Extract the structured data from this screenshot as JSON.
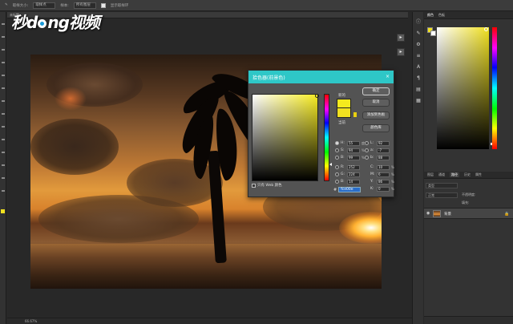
{
  "options_bar": {
    "sample_size_label": "取样大小:",
    "sample_size_value": "取样点",
    "sample_label": "样本:",
    "sample_value": "所有图层",
    "show_ring_label": "显示取样环"
  },
  "watermark": {
    "part1": "秒",
    "part2": "d",
    "part3": "ng视频"
  },
  "doc_tab": {
    "title": "未标题"
  },
  "color_panel": {
    "tabs": [
      "颜色",
      "色板"
    ],
    "fg_color": "#f0e020",
    "bg_color": "#ffffff"
  },
  "layers_panel": {
    "tabs": [
      "图层",
      "通道",
      "路径",
      "历史",
      "属性"
    ],
    "active_tab": "图层",
    "filter_label": "类型",
    "blend_mode": "正常",
    "opacity_label": "不透明度:",
    "fill_label": "填充:",
    "layer_name": "背景"
  },
  "status_bar": {
    "text": "66.67%"
  },
  "dialog": {
    "title": "拾色器(前景色)",
    "new_label": "新的",
    "current_label": "当前",
    "buttons": [
      "确定",
      "取消",
      "添加到色板",
      "颜色库"
    ],
    "only_web_label": "只有 Web 颜色",
    "hsb": [
      {
        "label": "H:",
        "value": "55",
        "unit": "度",
        "on": true
      },
      {
        "label": "S:",
        "value": "94",
        "unit": "%",
        "on": false
      },
      {
        "label": "B:",
        "value": "99",
        "unit": "%",
        "on": false
      }
    ],
    "rgb": [
      {
        "label": "R:",
        "value": "252",
        "on": false
      },
      {
        "label": "G:",
        "value": "224",
        "on": false
      },
      {
        "label": "B:",
        "value": "14",
        "on": false
      }
    ],
    "lab": [
      {
        "label": "L:",
        "value": "92",
        "on": false
      },
      {
        "label": "a:",
        "value": "-7",
        "on": false
      },
      {
        "label": "b:",
        "value": "88",
        "on": false
      }
    ],
    "cmyk": [
      {
        "label": "C:",
        "value": "10",
        "unit": "%"
      },
      {
        "label": "M:",
        "value": "6",
        "unit": "%"
      },
      {
        "label": "Y:",
        "value": "86",
        "unit": "%"
      },
      {
        "label": "K:",
        "value": "0",
        "unit": "%"
      }
    ],
    "hex": "fce00e",
    "new_color": "#f5ea1e",
    "current_color": "#f0e020"
  }
}
